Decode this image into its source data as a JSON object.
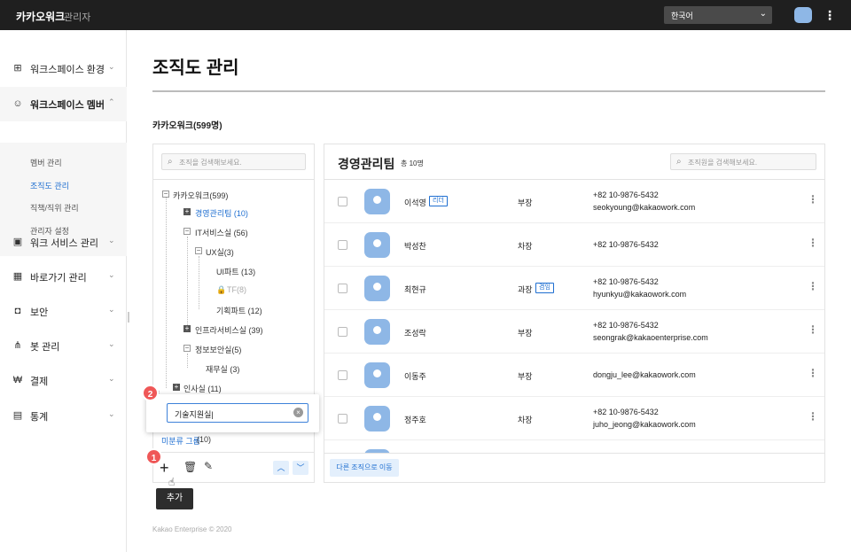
{
  "topbar": {
    "brand": "카카오워크",
    "section": "관리자",
    "language": "한국어"
  },
  "sidebar": {
    "items": [
      {
        "label": "워크스페이스 환경",
        "icon": "settings-sliders-icon"
      },
      {
        "label": "워크스페이스 멤버",
        "icon": "person-icon"
      },
      {
        "label": "워크 서비스 관리",
        "icon": "briefcase-icon"
      },
      {
        "label": "바로가기 관리",
        "icon": "grid-icon"
      },
      {
        "label": "보안",
        "icon": "lock-icon"
      },
      {
        "label": "봇 관리",
        "icon": "bot-icon"
      },
      {
        "label": "결제",
        "icon": "won-icon"
      },
      {
        "label": "통계",
        "icon": "chart-icon"
      }
    ],
    "submenu": [
      "멤버 관리",
      "조직도 관리",
      "직책/직위 관리",
      "관리자 설정"
    ]
  },
  "page": {
    "title": "조직도 관리",
    "org_name": "카카오워크(599명)",
    "copyright": "Kakao Enterprise © 2020"
  },
  "tree": {
    "search_placeholder": "조직을 검색해보세요.",
    "nodes": [
      "카카오워크(599)",
      "경영관리팀 (10)",
      "IT서비스실 (56)",
      "UX실(3)",
      "UI파트 (13)",
      "TF(8)",
      "기획파트 (12)",
      "인프라서비스실 (39)",
      "정보보안실(5)",
      "재무실 (3)",
      "인사실 (11)"
    ],
    "unassigned_label": "미분류 그룹",
    "unassigned_count": "(10)",
    "new_input_value": "기술지원실",
    "tooltip": "추가",
    "callout_1": "1",
    "callout_2": "2"
  },
  "list": {
    "title": "경영관리팀",
    "count": "총 10명",
    "search_placeholder": "조직원을 검색해보세요.",
    "members": [
      {
        "name": "이석영",
        "tag": "리더",
        "position": "부장",
        "phone": "+82 10-9876-5432",
        "email": "seokyoung@kakaowork.com"
      },
      {
        "name": "박성찬",
        "tag": "",
        "position": "차장",
        "phone": "+82 10-9876-5432",
        "email": ""
      },
      {
        "name": "최현규",
        "tag": "겸임",
        "position": "과장",
        "phone": "+82 10-9876-5432",
        "email": "hyunkyu@kakaowork.com"
      },
      {
        "name": "조성락",
        "tag": "",
        "position": "부장",
        "phone": "+82 10-9876-5432",
        "email": "seongrak@kakaoenterprise.com"
      },
      {
        "name": "이동주",
        "tag": "",
        "position": "부장",
        "phone": "",
        "email": "dongju_lee@kakaowork.com"
      },
      {
        "name": "정주호",
        "tag": "",
        "position": "차장",
        "phone": "+82 10-9876-5432",
        "email": "juho_jeong@kakaowork.com"
      }
    ],
    "move_button": "다른 조직으로 이동"
  }
}
